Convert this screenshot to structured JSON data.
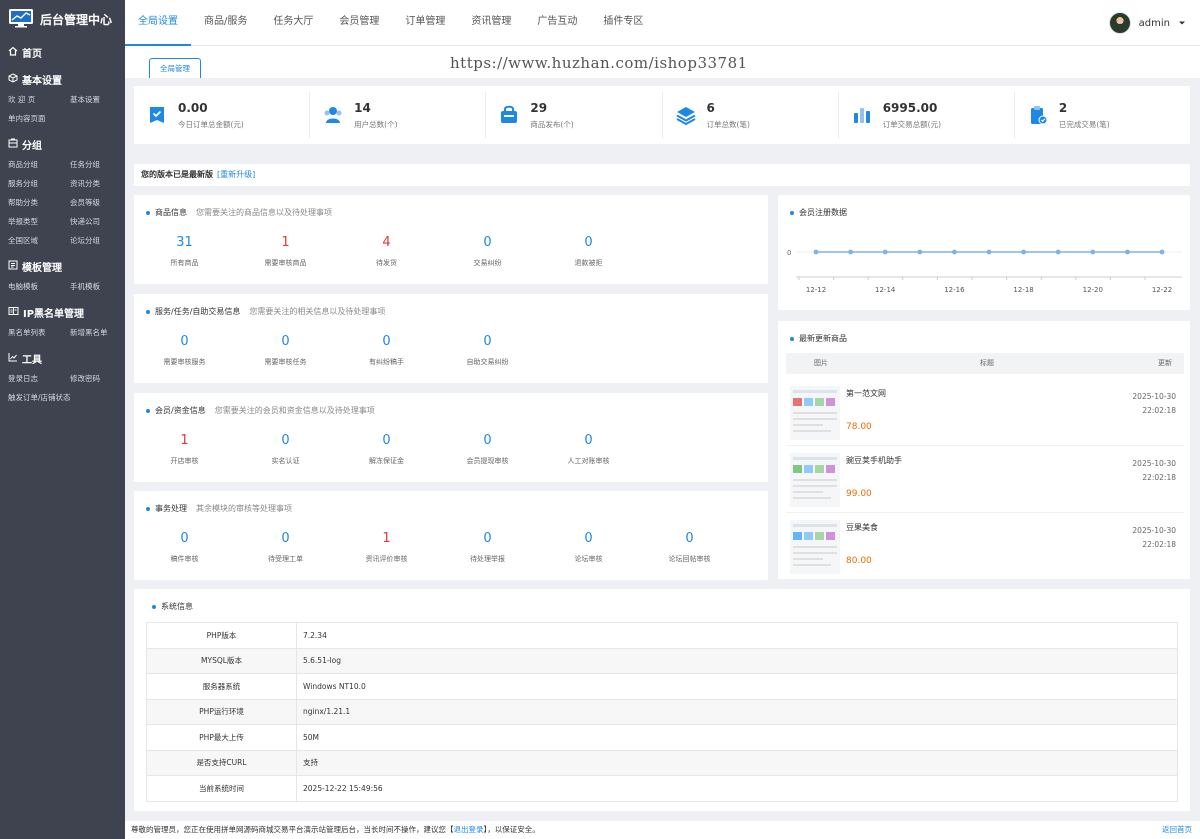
{
  "app": {
    "title": "后台管理中心"
  },
  "sidebar": {
    "home": "首页",
    "groups": [
      {
        "title": "基本设置",
        "icon": "cube-icon",
        "items": [
          "欢 迎 页",
          "基本设置",
          "单内容页面"
        ]
      },
      {
        "title": "分组",
        "icon": "group-icon",
        "items": [
          "商品分组",
          "任务分组",
          "服务分组",
          "资讯分类",
          "帮助分类",
          "会员等级",
          "举报类型",
          "快递公司",
          "全国区域",
          "论坛分组"
        ]
      },
      {
        "title": "模板管理",
        "icon": "template-icon",
        "items": [
          "电脑模板",
          "手机模板"
        ]
      },
      {
        "title": "IP黑名单管理",
        "icon": "blacklist-icon",
        "items": [
          "黑名单列表",
          "新增黑名单"
        ]
      },
      {
        "title": "工具",
        "icon": "chart-icon",
        "items": [
          "登录日志",
          "修改密码",
          "触发订单/店铺状态"
        ]
      }
    ]
  },
  "header": {
    "nav": [
      "全局设置",
      "商品/服务",
      "任务大厅",
      "会员管理",
      "订单管理",
      "资讯管理",
      "广告互动",
      "插件专区"
    ],
    "active_index": 0,
    "user": "admin"
  },
  "tabs": [
    "全局管理"
  ],
  "watermark": "https://www.huzhan.com/ishop33781",
  "stats": [
    {
      "value": "0.00",
      "label": "今日订单总金额(元)",
      "icon": "wallet-check-icon"
    },
    {
      "value": "14",
      "label": "用户总数(个)",
      "icon": "users-icon"
    },
    {
      "value": "29",
      "label": "商品发布(个)",
      "icon": "shop-bag-icon"
    },
    {
      "value": "6",
      "label": "订单总数(笔)",
      "icon": "layers-icon"
    },
    {
      "value": "6995.00",
      "label": "订单交易总额(元)",
      "icon": "bar-chart-icon"
    },
    {
      "value": "2",
      "label": "已完成交易(笔)",
      "icon": "clipboard-done-icon"
    }
  ],
  "notice": {
    "text": "您的版本已是最新版",
    "link": "[重新升级]"
  },
  "sections": [
    {
      "title": "商品信息",
      "desc": "您需要关注的商品信息以及待处理事项",
      "items": [
        {
          "value": "31",
          "label": "所有商品",
          "highlight": false
        },
        {
          "value": "1",
          "label": "需要审核商品",
          "highlight": true
        },
        {
          "value": "4",
          "label": "待发货",
          "highlight": true
        },
        {
          "value": "0",
          "label": "交易纠纷",
          "highlight": false
        },
        {
          "value": "0",
          "label": "退款被拒",
          "highlight": false
        }
      ]
    },
    {
      "title": "服务/任务/自助交易信息",
      "desc": "您需要关注的相关信息以及待处理事项",
      "items": [
        {
          "value": "0",
          "label": "需要审核服务",
          "highlight": false
        },
        {
          "value": "0",
          "label": "需要审核任务",
          "highlight": false
        },
        {
          "value": "0",
          "label": "有纠纷稿手",
          "highlight": false
        },
        {
          "value": "0",
          "label": "自助交易纠纷",
          "highlight": false
        }
      ]
    },
    {
      "title": "会员/资金信息",
      "desc": "您需要关注的会员和资金信息以及待处理事项",
      "items": [
        {
          "value": "1",
          "label": "开店审核",
          "highlight": true
        },
        {
          "value": "0",
          "label": "实名认证",
          "highlight": false
        },
        {
          "value": "0",
          "label": "解冻保证金",
          "highlight": false
        },
        {
          "value": "0",
          "label": "会员提现审核",
          "highlight": false
        },
        {
          "value": "0",
          "label": "人工对账审核",
          "highlight": false
        }
      ]
    },
    {
      "title": "事务处理",
      "desc": "其余模块的审核等处理事项",
      "items": [
        {
          "value": "0",
          "label": "稿件审核",
          "highlight": false
        },
        {
          "value": "0",
          "label": "待受理工单",
          "highlight": false
        },
        {
          "value": "1",
          "label": "资讯评价审核",
          "highlight": true
        },
        {
          "value": "0",
          "label": "待处理举报",
          "highlight": false
        },
        {
          "value": "0",
          "label": "论坛审核",
          "highlight": false
        },
        {
          "value": "0",
          "label": "论坛回帖审核",
          "highlight": false
        }
      ]
    }
  ],
  "chart": {
    "title": "会员注册数据",
    "chart_data": {
      "type": "line",
      "x": [
        "12-12",
        "12-13",
        "12-14",
        "12-15",
        "12-16",
        "12-17",
        "12-18",
        "12-19",
        "12-20",
        "12-21",
        "12-22"
      ],
      "x_tick_labels": [
        "12-12",
        "12-14",
        "12-16",
        "12-18",
        "12-20",
        "12-22"
      ],
      "values": [
        0,
        0,
        0,
        0,
        0,
        0,
        0,
        0,
        0,
        0,
        0
      ],
      "y_tick_labels": [
        "0"
      ],
      "color": "#7fb3e8"
    }
  },
  "products": {
    "title": "最新更新商品",
    "columns": [
      "图片",
      "标题",
      "更新"
    ],
    "rows": [
      {
        "title": "第一范文网",
        "price": "78.00",
        "date": "2025-10-30",
        "time": "22:02:18"
      },
      {
        "title": "豌豆荚手机助手",
        "price": "99.00",
        "date": "2025-10-30",
        "time": "22:02:18"
      },
      {
        "title": "豆果美食",
        "price": "80.00",
        "date": "2025-10-30",
        "time": "22:02:18"
      }
    ]
  },
  "sysinfo": {
    "title": "系统信息",
    "rows": [
      {
        "key": "PHP版本",
        "value": "7.2.34"
      },
      {
        "key": "MYSQL版本",
        "value": "5.6.51-log"
      },
      {
        "key": "服务器系统",
        "value": "Windows NT10.0"
      },
      {
        "key": "PHP运行环境",
        "value": "nginx/1.21.1"
      },
      {
        "key": "PHP最大上传",
        "value": "50M"
      },
      {
        "key": "是否支持CURL",
        "value": "支持"
      },
      {
        "key": "当前系统时间",
        "value": "2025-12-22 15:49:56"
      }
    ]
  },
  "footer": {
    "text_before": "尊敬的管理员，您正在使用拼单网源码商城交易平台演示站管理后台，当长时间不操作，建议您【",
    "logout_link": "退出登录",
    "text_after": "】，以保证安全。",
    "home_link": "返回首页"
  },
  "colors": {
    "sidebar": "#3f4350",
    "accent": "#1e88e5",
    "alert": "#e53935",
    "price": "#ef6c00"
  }
}
